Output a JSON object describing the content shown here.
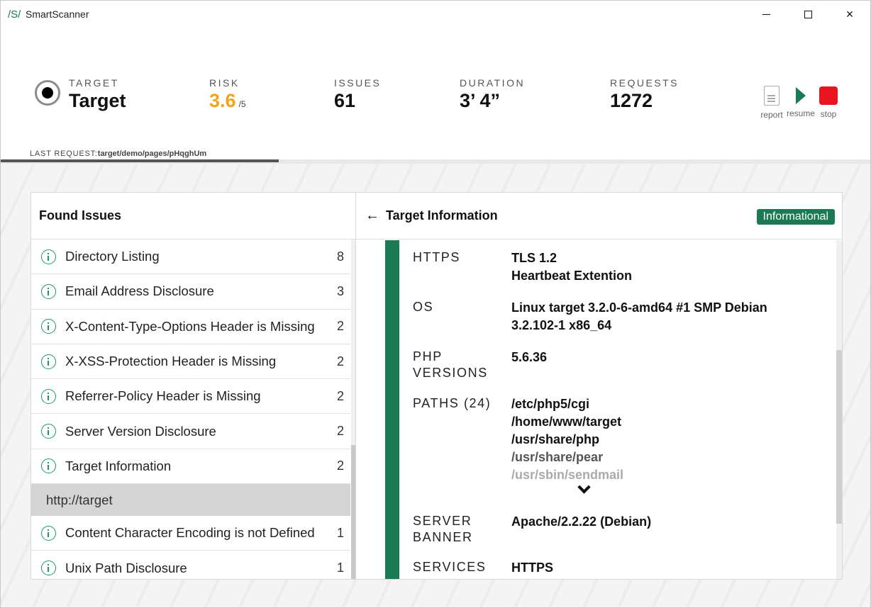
{
  "app": {
    "logo": "/S/",
    "title": "SmartScanner"
  },
  "window_controls": {
    "minimize": "minimize",
    "maximize": "maximize",
    "close": "×"
  },
  "stats": {
    "target": {
      "label": "TARGET",
      "value": "Target"
    },
    "risk": {
      "label": "RISK",
      "value": "3.6",
      "max": "/5"
    },
    "issues": {
      "label": "ISSUES",
      "value": "61"
    },
    "duration": {
      "label": "DURATION",
      "value": "3’ 4”"
    },
    "requests": {
      "label": "REQUESTS",
      "value": "1272"
    }
  },
  "actions": {
    "report": "report",
    "resume": "resume",
    "stop": "stop"
  },
  "last_request": {
    "label": "LAST REQUEST:",
    "value": "target/demo/pages/pHqghUm"
  },
  "progress": {
    "fraction": 0.32
  },
  "found_issues": {
    "title": "Found Issues",
    "items": [
      {
        "type": "issue",
        "name": "Directory Listing",
        "count": "8"
      },
      {
        "type": "issue",
        "name": "Email Address Disclosure",
        "count": "3"
      },
      {
        "type": "issue",
        "name": "X-Content-Type-Options Header is Missing",
        "count": "2"
      },
      {
        "type": "issue",
        "name": "X-XSS-Protection Header is Missing",
        "count": "2"
      },
      {
        "type": "issue",
        "name": "Referrer-Policy Header is Missing",
        "count": "2"
      },
      {
        "type": "issue",
        "name": "Server Version Disclosure",
        "count": "2"
      },
      {
        "type": "issue",
        "name": "Target Information",
        "count": "2"
      },
      {
        "type": "group",
        "name": "http://target"
      },
      {
        "type": "issue",
        "name": "Content Character Encoding is not Defined",
        "count": "1"
      },
      {
        "type": "issue",
        "name": "Unix Path Disclosure",
        "count": "1"
      }
    ]
  },
  "detail": {
    "back": "←",
    "title": "Target Information",
    "severity": "Informational",
    "rows": {
      "https": {
        "label": "HTTPS",
        "values": [
          "TLS 1.2",
          "Heartbeat Extention"
        ]
      },
      "os": {
        "label": "OS",
        "values": [
          "Linux target 3.2.0-6-amd64 #1 SMP Debian",
          "3.2.102-1 x86_64"
        ]
      },
      "php": {
        "label": [
          "PHP",
          "VERSIONS"
        ],
        "values": [
          "5.6.36"
        ]
      },
      "paths": {
        "label": "PATHS (24)",
        "values": [
          "/etc/php5/cgi",
          "/home/www/target",
          "/usr/share/php",
          "/usr/share/pear",
          "/usr/sbin/sendmail"
        ]
      },
      "banner": {
        "label": [
          "SERVER",
          "BANNER"
        ],
        "values": [
          "Apache/2.2.22 (Debian)"
        ]
      },
      "services": {
        "label": "SERVICES",
        "values": [
          "HTTPS"
        ]
      }
    }
  },
  "colors": {
    "accent": "#1a7a52",
    "risk": "#f5a31a",
    "stop": "#e8141e"
  }
}
